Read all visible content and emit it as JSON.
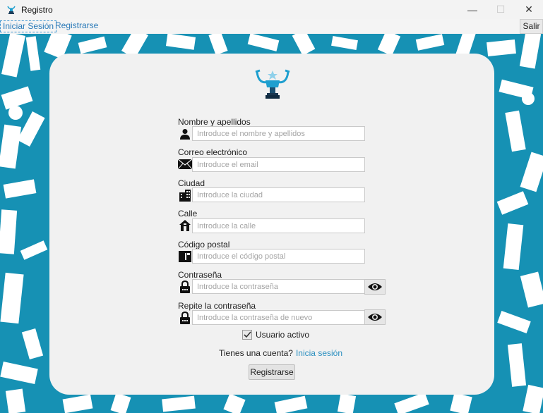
{
  "window": {
    "title": "Registro",
    "icons": {
      "app": "trophy-icon",
      "minimize": "minimize-icon",
      "maximize": "maximize-icon",
      "close": "close-icon"
    }
  },
  "menu": {
    "login_link": "Iniciar Sesión",
    "register_link": "Registrarse",
    "exit_button": "Salir"
  },
  "colors": {
    "background": "#1691b4",
    "card": "#f1f1f1",
    "link": "#2a7ab8",
    "logo": "#1e9fcf"
  },
  "form": {
    "logo_icon": "trophy-logo-icon",
    "fields": [
      {
        "label": "Nombre y apellidos",
        "placeholder": "Introduce el nombre y apellidos",
        "value": "",
        "icon": "person-icon"
      },
      {
        "label": "Correo electrónico",
        "placeholder": "Introduce el email",
        "value": "",
        "icon": "envelope-icon"
      },
      {
        "label": "Ciudad",
        "placeholder": "Introduce la ciudad",
        "value": "",
        "icon": "city-icon"
      },
      {
        "label": "Calle",
        "placeholder": "Introduce la calle",
        "value": "",
        "icon": "house-icon"
      },
      {
        "label": "Código postal",
        "placeholder": "Introduce el código postal",
        "value": "",
        "icon": "postal-code-icon"
      },
      {
        "label": "Contraseña",
        "placeholder": "Introduce la contraseña",
        "value": "",
        "icon": "lock-icon",
        "toggle_icon": "eye-icon"
      },
      {
        "label": "Repite la contraseña",
        "placeholder": "Introduce la contraseña de nuevo",
        "value": "",
        "icon": "lock-icon",
        "toggle_icon": "eye-icon"
      }
    ],
    "active_checkbox": {
      "label": "Usuario activo",
      "checked": true
    },
    "have_account_text": "Tienes una cuenta?",
    "login_link": "Inicia sesión",
    "submit_button": "Registrarse"
  }
}
